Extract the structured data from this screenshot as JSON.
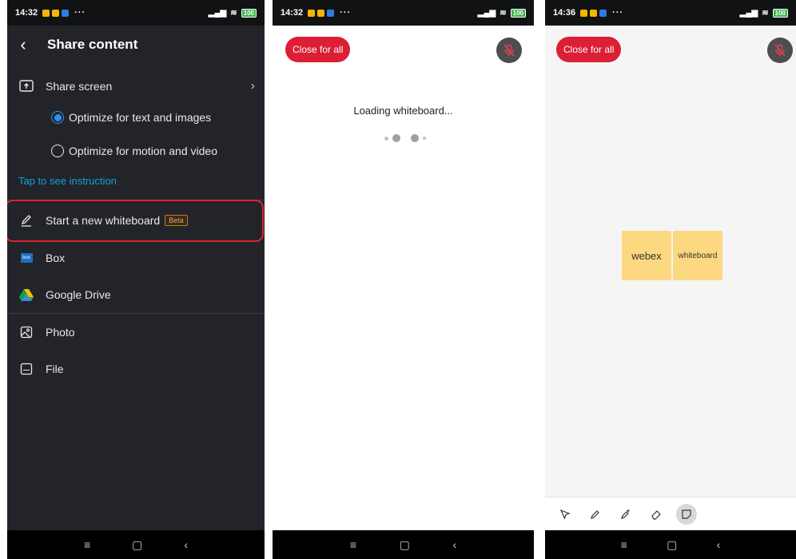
{
  "panel1": {
    "status": {
      "time": "14:32",
      "battery": "100"
    },
    "header": {
      "title": "Share content"
    },
    "share_screen": {
      "label": "Share screen"
    },
    "option_text": {
      "label": "Optimize for text and images"
    },
    "option_motion": {
      "label": "Optimize for motion and video"
    },
    "instruction_link": "Tap to see instruction",
    "whiteboard": {
      "label": "Start a new whiteboard",
      "badge": "Beta"
    },
    "box": {
      "label": "Box",
      "icon_text": "box"
    },
    "google_drive": {
      "label": "Google Drive"
    },
    "photo": {
      "label": "Photo"
    },
    "file": {
      "label": "File"
    }
  },
  "panel2": {
    "status": {
      "time": "14:32",
      "battery": "100"
    },
    "close_button": "Close for all",
    "loading_text": "Loading whiteboard..."
  },
  "panel3": {
    "status": {
      "time": "14:36",
      "battery": "100"
    },
    "close_button": "Close for all",
    "sticky_notes": [
      "webex",
      "whiteboard"
    ],
    "toolbar_tools": [
      "select-tool",
      "pen-tool",
      "magic-pen-tool",
      "eraser-tool",
      "sticky-note-tool"
    ]
  },
  "colors": {
    "accent_red": "#dc1f35",
    "link_blue": "#14a0d6",
    "radio_blue": "#2f8ff0",
    "sticky_yellow": "#fcd980",
    "dark_bg": "#222429"
  }
}
